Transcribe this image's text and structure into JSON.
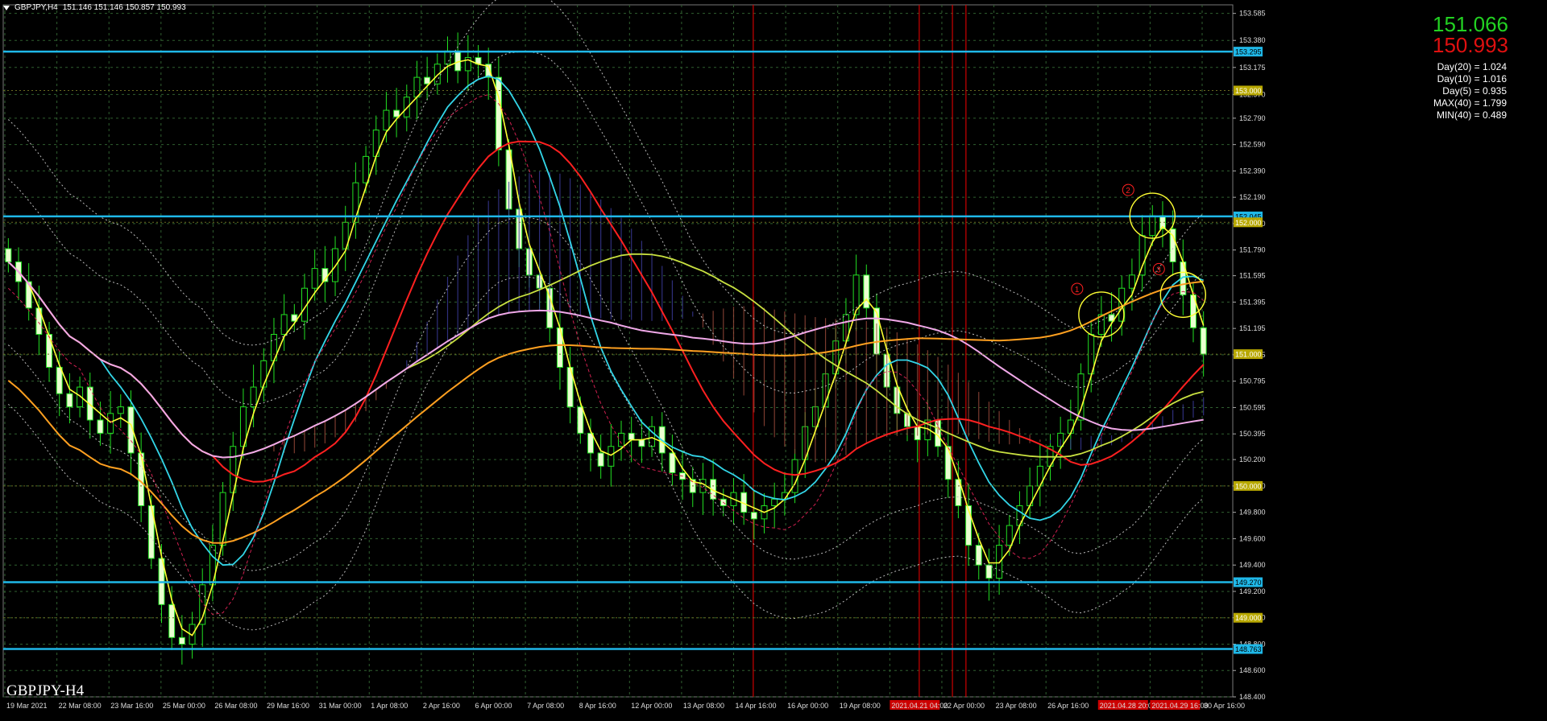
{
  "header": {
    "symbol": "GBPJPY,H4",
    "ohlc": "151.146 151.146 150.857 150.993"
  },
  "watermark": "GBPJPY-H4",
  "prices": {
    "ask": "151.066",
    "bid": "150.993",
    "ask_color": "#22d222",
    "bid_color": "#e01010"
  },
  "stats": [
    "Day(20) = 1.024",
    "Day(10) = 1.016",
    "Day(5) = 0.935",
    "MAX(40) = 1.799",
    "MIN(40) = 0.489"
  ],
  "colors": {
    "background": "#000000",
    "candle": "#22e022",
    "hline": "#1fb8e8",
    "vline": "#cc0000",
    "grid": "#2f5f2f"
  },
  "chart_data": {
    "type": "candlestick",
    "y_axis": {
      "min": 148.4,
      "max": 153.65,
      "ticks": [
        "153.585",
        "153.380",
        "153.175",
        "152.970",
        "152.790",
        "152.590",
        "152.390",
        "152.190",
        "151.990",
        "151.790",
        "151.595",
        "151.395",
        "151.195",
        "150.995",
        "150.795",
        "150.595",
        "150.395",
        "150.200",
        "150.000",
        "149.800",
        "149.600",
        "149.400",
        "149.200",
        "149.000",
        "148.800",
        "148.600",
        "148.400"
      ]
    },
    "x_axis": {
      "labels": [
        "19 Mar 2021",
        "22 Mar 08:00",
        "23 Mar 16:00",
        "25 Mar 00:00",
        "26 Mar 08:00",
        "29 Mar 16:00",
        "31 Mar 00:00",
        "1 Apr 08:00",
        "2 Apr 16:00",
        "6 Apr 00:00",
        "7 Apr 08:00",
        "8 Apr 16:00",
        "12 Apr 00:00",
        "13 Apr 08:00",
        "14 Apr 16:00",
        "16 Apr 00:00",
        "19 Apr 08:00",
        "2021.04.21 04:00",
        "22 Apr 00:00",
        "23 Apr 08:00",
        "26 Apr 16:00",
        "2021.04.28 20:00",
        "2021.04.29 16:00",
        "30 Apr 16:00"
      ],
      "highlighted": [
        "2021.04.21 04:00",
        "2021.04.28 20:00",
        "2021.04.29 16:00"
      ]
    },
    "horizontal_levels": [
      {
        "value": 153.295,
        "label": "153.295",
        "color": "#1fb8e8"
      },
      {
        "value": 153.0,
        "label": "153.000",
        "color": "#b8a800"
      },
      {
        "value": 152.045,
        "label": "152.045",
        "color": "#1fb8e8"
      },
      {
        "value": 152.0,
        "label": "152.000",
        "color": "#b8a800"
      },
      {
        "value": 151.0,
        "label": "151.000",
        "color": "#b8a800"
      },
      {
        "value": 150.0,
        "label": "150.000",
        "color": "#b8a800"
      },
      {
        "value": 149.27,
        "label": "149.270",
        "color": "#1fb8e8"
      },
      {
        "value": 149.0,
        "label": "149.000",
        "color": "#b8a800"
      },
      {
        "value": 148.763,
        "label": "148.763",
        "color": "#1fb8e8"
      }
    ],
    "closes": [
      151.7,
      151.55,
      151.35,
      151.15,
      150.9,
      150.7,
      150.6,
      150.75,
      150.5,
      150.4,
      150.55,
      150.6,
      150.25,
      149.85,
      149.45,
      149.1,
      148.85,
      148.8,
      148.95,
      149.25,
      149.55,
      149.95,
      150.3,
      150.6,
      150.75,
      150.95,
      151.15,
      151.3,
      151.25,
      151.5,
      151.65,
      151.55,
      151.8,
      152.0,
      152.3,
      152.5,
      152.7,
      152.85,
      152.8,
      152.95,
      153.1,
      153.05,
      153.2,
      153.3,
      153.15,
      153.25,
      153.2,
      153.1,
      152.55,
      152.1,
      151.8,
      151.6,
      151.5,
      151.2,
      150.9,
      150.6,
      150.4,
      150.25,
      150.15,
      150.3,
      150.4,
      150.35,
      150.3,
      150.45,
      150.25,
      150.1,
      150.05,
      149.95,
      150.05,
      149.9,
      149.85,
      149.95,
      149.8,
      149.75,
      149.85,
      149.9,
      149.95,
      150.2,
      150.45,
      150.6,
      150.85,
      151.1,
      151.3,
      151.6,
      151.35,
      151.0,
      150.75,
      150.55,
      150.45,
      150.35,
      150.5,
      150.3,
      150.05,
      149.85,
      149.55,
      149.4,
      149.3,
      149.55,
      149.7,
      149.85,
      150.0,
      150.15,
      150.3,
      150.4,
      150.5,
      150.85,
      151.15,
      151.3,
      151.25,
      151.5,
      151.6,
      151.9,
      152.05,
      151.95,
      151.7,
      151.45,
      151.2,
      151.0
    ],
    "x_range": [
      0,
      118
    ],
    "markers": [
      {
        "label": "1",
        "index": 107
      },
      {
        "label": "2",
        "index": 112
      },
      {
        "label": "3",
        "index": 115
      }
    ]
  }
}
